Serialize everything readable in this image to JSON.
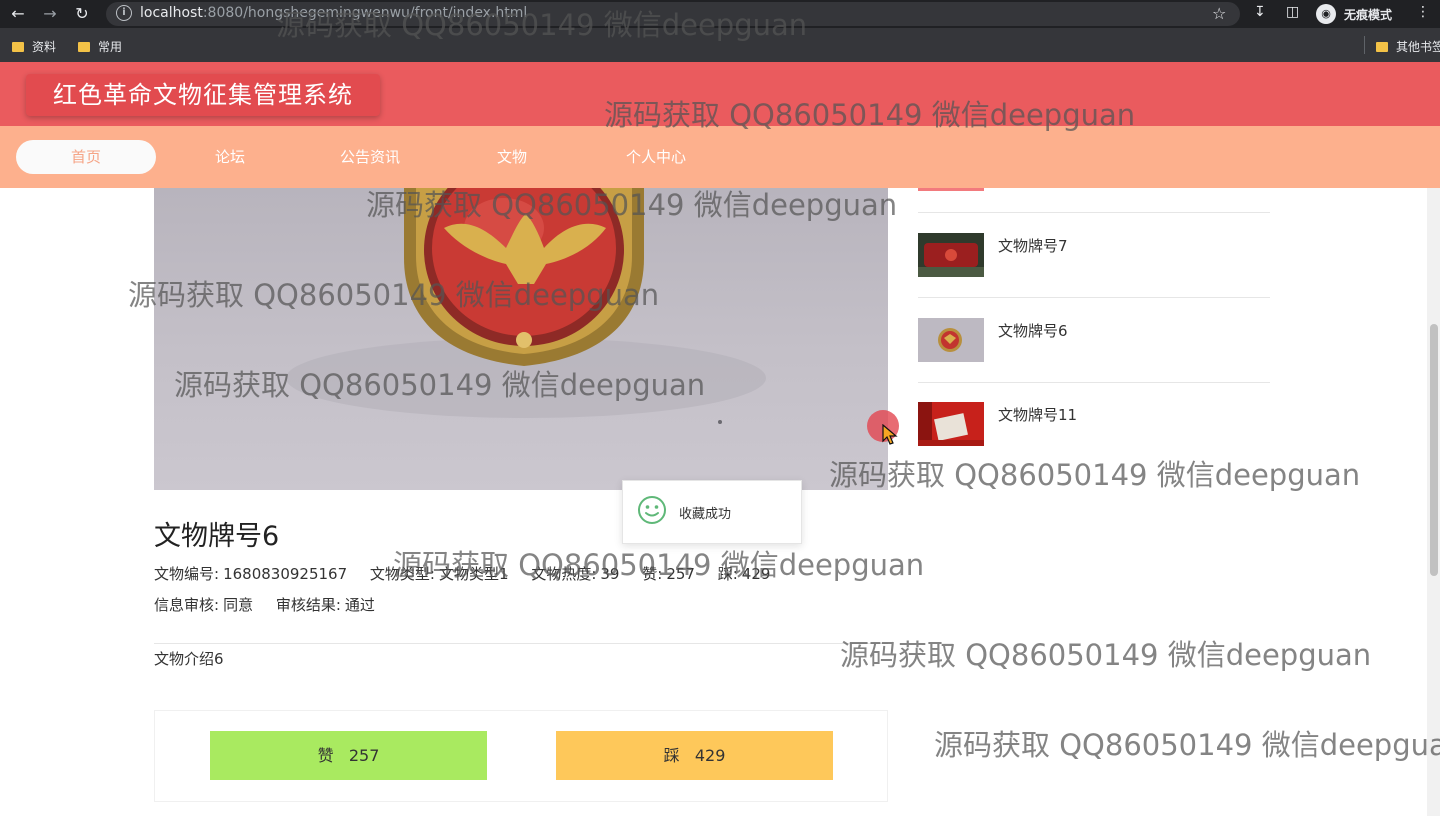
{
  "browser": {
    "url_host": "localhost",
    "url_path": ":8080/hongshegemingwenwu/front/index.html",
    "profile_label": "无痕模式",
    "bookmarks": [
      {
        "label": "资料"
      },
      {
        "label": "常用"
      }
    ],
    "other_bookmarks": "其他书签"
  },
  "header": {
    "site_title": "红色革命文物征集管理系统"
  },
  "nav": {
    "items": [
      {
        "label": "首页",
        "active": true
      },
      {
        "label": "论坛"
      },
      {
        "label": "公告资讯"
      },
      {
        "label": "文物"
      },
      {
        "label": "个人中心"
      }
    ]
  },
  "sidebar": {
    "items": [
      {
        "title": "文物牌号7"
      },
      {
        "title": "文物牌号6"
      },
      {
        "title": "文物牌号11"
      }
    ]
  },
  "toast": {
    "message": "收藏成功"
  },
  "detail": {
    "title": "文物牌号6",
    "fields_row1": [
      {
        "label": "文物编号:",
        "value": "1680830925167"
      },
      {
        "label": "文物类型:",
        "value": "文物类型1"
      },
      {
        "label": "文物热度:",
        "value": "39"
      },
      {
        "label": "赞:",
        "value": "257"
      },
      {
        "label": "踩:",
        "value": "429"
      }
    ],
    "fields_row2": [
      {
        "label": "信息审核:",
        "value": "同意"
      },
      {
        "label": "审核结果:",
        "value": "通过"
      }
    ],
    "intro": "文物介绍6"
  },
  "votes": {
    "like_label": "赞",
    "like_count": "257",
    "dislike_label": "踩",
    "dislike_count": "429"
  },
  "watermark": {
    "text": "源码获取 QQ86050149 微信deepguan",
    "text_clipped": "源码获取 QQ86050149 微信deepgua"
  },
  "colors": {
    "header_bg": "#ea5b5e",
    "nav_bg": "#fdb08d",
    "like_bg": "#a9ea60",
    "dislike_bg": "#fec85a"
  }
}
